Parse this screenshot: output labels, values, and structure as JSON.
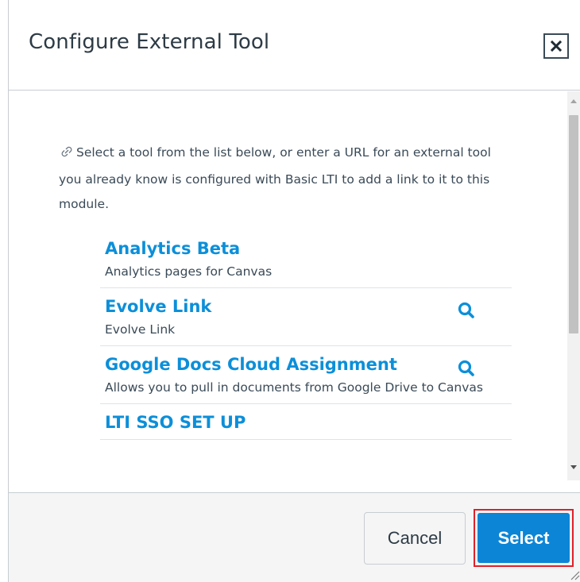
{
  "dialog": {
    "title": "Configure External Tool",
    "close_label": "Close"
  },
  "intro": {
    "text": "Select a tool from the list below, or enter a URL for an external tool you already know is configured with Basic LTI to add a link to it to this module."
  },
  "tools": [
    {
      "name": "Analytics Beta",
      "description": "Analytics pages for Canvas",
      "has_search_icon": false
    },
    {
      "name": "Evolve Link",
      "description": "Evolve Link",
      "has_search_icon": true
    },
    {
      "name": "Google Docs Cloud Assignment",
      "description": "Allows you to pull in documents from Google Drive to Canvas",
      "has_search_icon": true
    },
    {
      "name": "LTI SSO SET UP",
      "description": "",
      "has_search_icon": false
    }
  ],
  "footer": {
    "cancel_label": "Cancel",
    "select_label": "Select"
  },
  "colors": {
    "link": "#0c8fd9",
    "primary_button": "#0c85d6",
    "highlight_outline": "#e0202a"
  },
  "icons": {
    "close": "close-icon",
    "link": "link-icon",
    "search": "search-icon"
  }
}
